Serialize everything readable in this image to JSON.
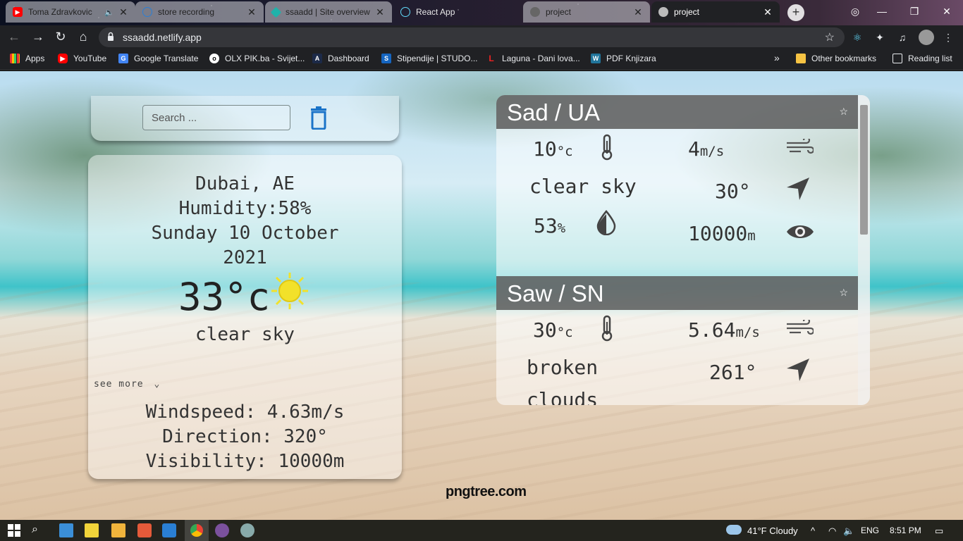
{
  "browser": {
    "tabs": [
      {
        "title": "Toma Zdravkovic",
        "favicon": "youtube-icon"
      },
      {
        "title": "store recording",
        "favicon": "react-icon"
      },
      {
        "title": "ssaadd | Site overview",
        "favicon": "netlify-icon"
      },
      {
        "title": "React App",
        "favicon": "react-icon"
      },
      {
        "title": "project",
        "favicon": "globe-icon"
      },
      {
        "title": "project",
        "favicon": "globe-icon"
      }
    ],
    "url": "ssaadd.netlify.app",
    "bookmarks": [
      {
        "label": "Apps"
      },
      {
        "label": "YouTube"
      },
      {
        "label": "Google Translate"
      },
      {
        "label": "OLX PIK.ba - Svijet..."
      },
      {
        "label": "Dashboard"
      },
      {
        "label": "Stipendije | STUDO..."
      },
      {
        "label": "Laguna - Dani lova..."
      },
      {
        "label": "PDF Knjizara"
      }
    ],
    "overflow": "»",
    "other_bookmarks": "Other bookmarks",
    "reading_list": "Reading list"
  },
  "search": {
    "placeholder": "Search ..."
  },
  "main": {
    "city": "Dubai, AE",
    "humidity": "Humidity:58%",
    "date_line1": "Sunday 10 October",
    "date_line2": "2021",
    "temperature": "33°c",
    "description": "clear sky",
    "see_more": "see more",
    "see_more_caret": "⌄",
    "windspeed": "Windspeed: 4.63m/s",
    "direction": "Direction: 320°",
    "visibility": "Visibility: 10000m"
  },
  "favorites": [
    {
      "name": "Sad / UA",
      "temp_value": "10",
      "temp_unit": "°c",
      "wind_value": "4",
      "wind_unit": "m/s",
      "description": "clear sky",
      "direction": "30°",
      "humidity_value": "53",
      "humidity_unit": "%",
      "visibility_value": "10000",
      "visibility_unit": "m"
    },
    {
      "name": "Saw / SN",
      "temp_value": "30",
      "temp_unit": "°c",
      "wind_value": "5.64",
      "wind_unit": "m/s",
      "description_line1": "broken",
      "description_line2": "clouds",
      "direction": "261°"
    }
  ],
  "watermark": "pngtree.com",
  "taskbar": {
    "weather": "41°F  Cloudy",
    "language": "ENG",
    "time": "8:51 PM"
  },
  "colors": {
    "accent_blue": "#1a73c8",
    "sun_yellow": "#f2e12a",
    "header_gray": "#5a5a5a"
  }
}
